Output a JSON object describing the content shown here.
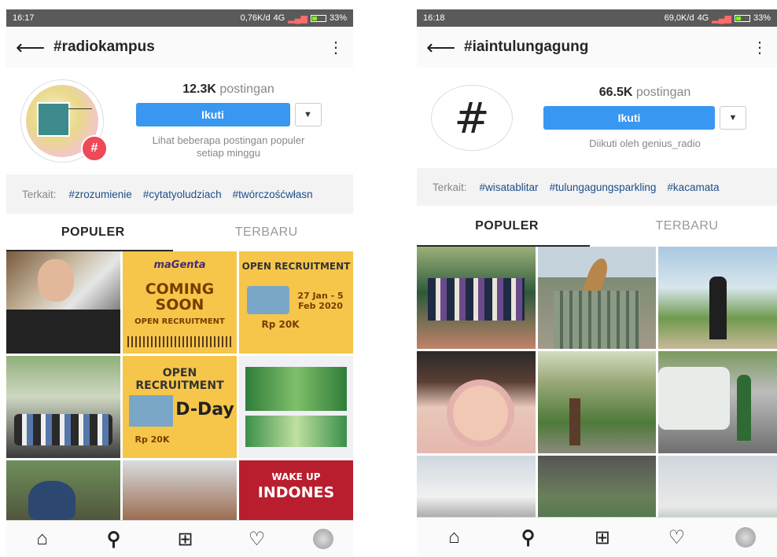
{
  "left": {
    "status": {
      "time": "16:17",
      "speed": "0,76K/d",
      "network": "4G",
      "battery": "33%"
    },
    "appbar": {
      "title": "#radiokampus"
    },
    "profile": {
      "count": "12.3K",
      "count_label": "postingan",
      "follow_label": "Ikuti",
      "subtitle": "Lihat beberapa postingan populer setiap minggu"
    },
    "related": {
      "label": "Terkait:",
      "tags": [
        "#zrozumienie",
        "#cytatyoludziach",
        "#twórczośćwłasn"
      ]
    },
    "tabs": {
      "popular": "POPULER",
      "recent": "TERBARU"
    },
    "grid": {
      "coming_soon": "COMING SOON",
      "open_recruitment": "OPEN RECRUITMENT",
      "open_recruitment_short": "OPEN",
      "dday": "D-Day",
      "price": "Rp 20K",
      "wake_up": "WAKE UP",
      "indones": "INDONES",
      "dates": "27 Jan - 5 Feb 2020"
    }
  },
  "right": {
    "status": {
      "time": "16:18",
      "speed": "69,0K/d",
      "network": "4G",
      "battery": "33%"
    },
    "appbar": {
      "title": "#iaintulungagung"
    },
    "profile": {
      "count": "66.5K",
      "count_label": "postingan",
      "follow_label": "Ikuti",
      "subtitle": "Diikuti oleh genius_radio"
    },
    "related": {
      "label": "Terkait:",
      "tags": [
        "#wisatablitar",
        "#tulungagungsparkling",
        "#kacamata"
      ]
    },
    "tabs": {
      "popular": "POPULER",
      "recent": "TERBARU"
    }
  },
  "colors": {
    "follow_button": "#3897f0",
    "badge": "#ed4956",
    "tag_link": "#1d4e89"
  },
  "icons": [
    "back-arrow-icon",
    "more-vertical-icon",
    "dropdown-caret-icon",
    "home-icon",
    "search-icon",
    "add-post-icon",
    "heart-icon",
    "profile-avatar-icon",
    "hashtag-icon"
  ]
}
